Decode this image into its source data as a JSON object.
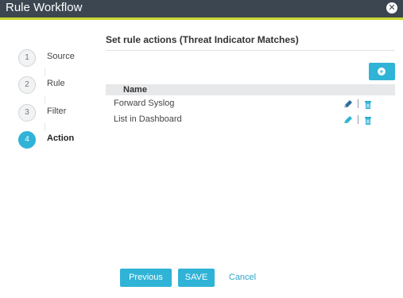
{
  "window": {
    "title": "Rule Workflow",
    "close_icon": "close-icon"
  },
  "stepper": {
    "steps": [
      {
        "number": "1",
        "label": "Source",
        "active": false
      },
      {
        "number": "2",
        "label": "Rule",
        "active": false
      },
      {
        "number": "3",
        "label": "Filter",
        "active": false
      },
      {
        "number": "4",
        "label": "Action",
        "active": true
      }
    ]
  },
  "main": {
    "section_title": "Set rule actions (Threat Indicator Matches)",
    "add_button_icon": "plus-circle-icon",
    "table": {
      "column_header": "Name",
      "rows": [
        {
          "name": "Forward Syslog"
        },
        {
          "name": "List in Dashboard"
        }
      ]
    }
  },
  "footer": {
    "previous_label": "Previous",
    "save_label": "SAVE",
    "cancel_label": "Cancel"
  },
  "colors": {
    "accent": "#2fb3d6",
    "titlebar": "#3b4650",
    "titlebar_underline": "#c9d832"
  }
}
